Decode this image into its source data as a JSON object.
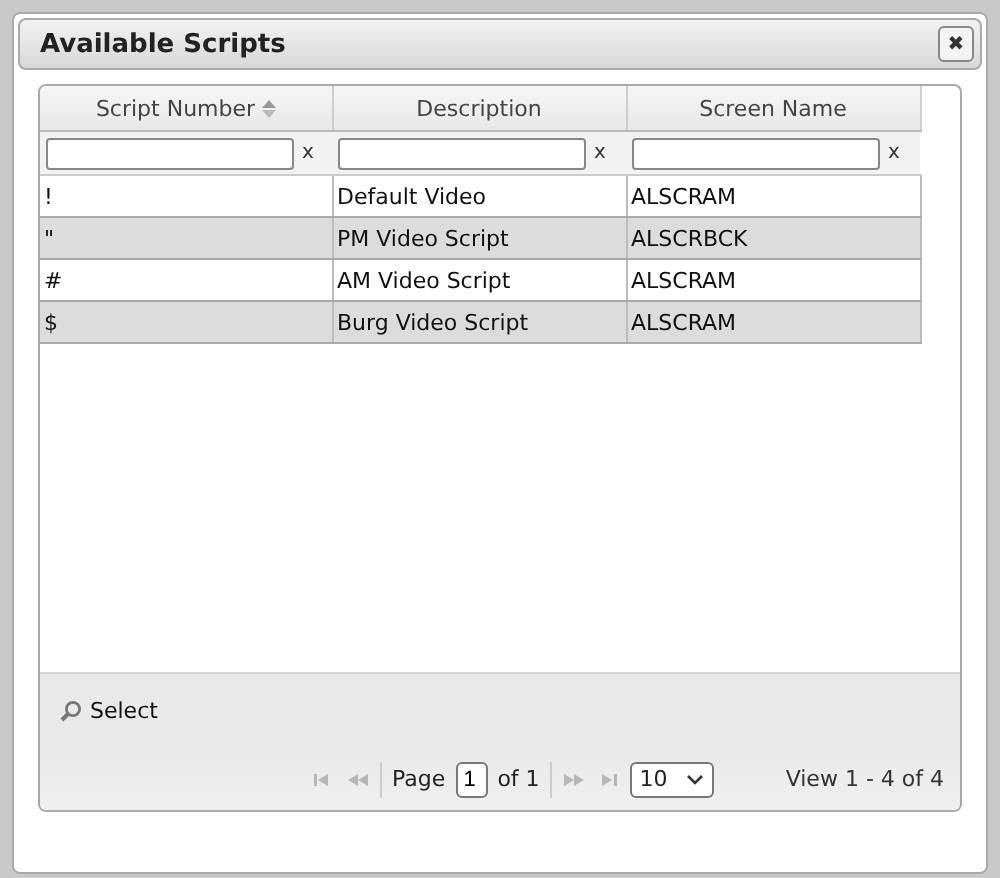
{
  "window": {
    "title": "Available Scripts",
    "close_icon": "✖"
  },
  "table": {
    "columns": [
      {
        "label": "Script Number",
        "sorted": true,
        "filter_clear": "x"
      },
      {
        "label": "Description",
        "sorted": false,
        "filter_clear": "x"
      },
      {
        "label": "Screen Name",
        "sorted": false,
        "filter_clear": "x"
      }
    ],
    "rows": [
      {
        "cells": [
          "!",
          "Default Video",
          "ALSCRAM"
        ]
      },
      {
        "cells": [
          "\"",
          "PM Video Script",
          "ALSCRBCK"
        ]
      },
      {
        "cells": [
          "#",
          "AM Video Script",
          "ALSCRAM"
        ]
      },
      {
        "cells": [
          "$",
          "Burg Video Script",
          "ALSCRAM"
        ]
      }
    ]
  },
  "toolbar": {
    "select_label": "Select"
  },
  "pager": {
    "page_label": "Page",
    "page": "1",
    "of_label": "of 1",
    "page_size": "10",
    "summary": "View 1 - 4 of 4"
  }
}
